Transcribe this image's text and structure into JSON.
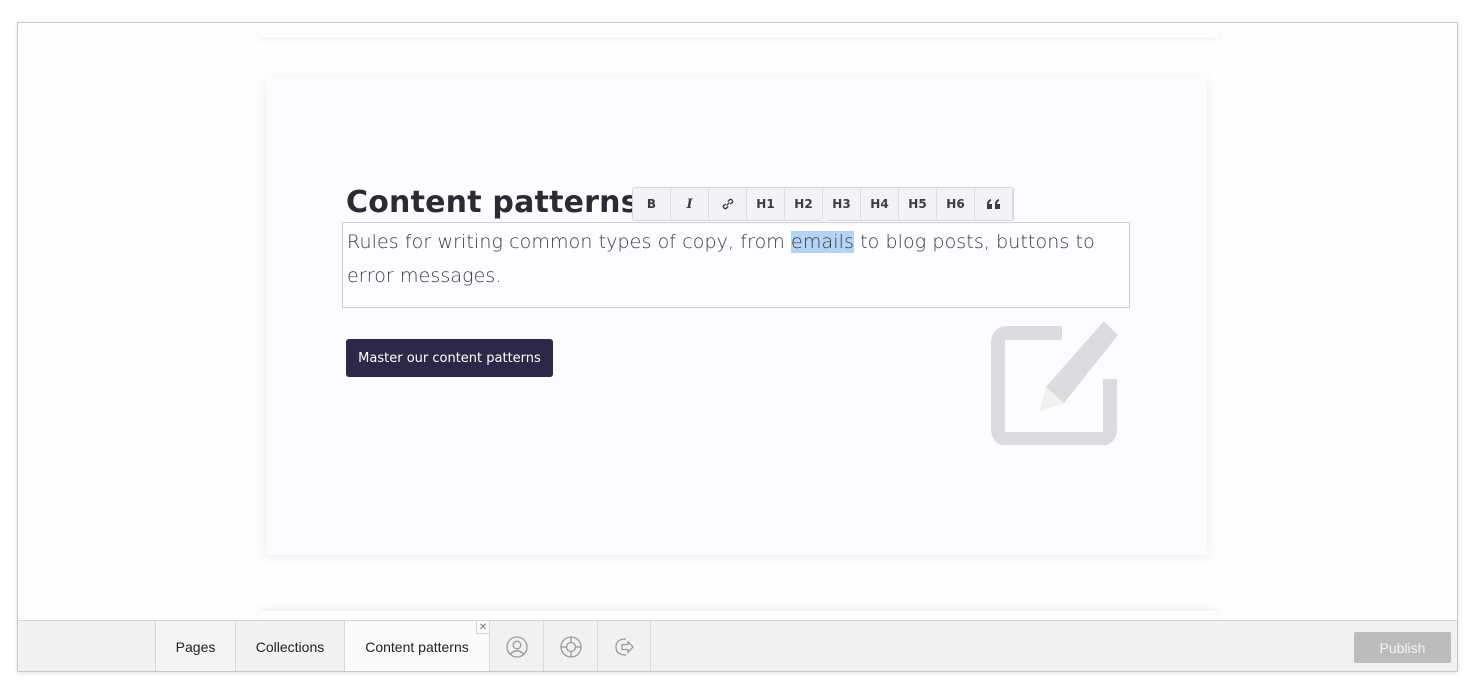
{
  "content": {
    "title": "Content patterns",
    "body_before": "Rules for writing common types of copy, from ",
    "body_selected": "emails",
    "body_after": " to blog posts, buttons to error messages.",
    "cta_label": "Master our content patterns",
    "watermark_icon": "edit-icon"
  },
  "toolbar": {
    "buttons": [
      {
        "label": "B",
        "icon": "bold-icon"
      },
      {
        "label": "I",
        "icon": "italic-icon"
      },
      {
        "label": "",
        "icon": "link-icon"
      },
      {
        "label": "H1"
      },
      {
        "label": "H2"
      },
      {
        "label": "H3"
      },
      {
        "label": "H4"
      },
      {
        "label": "H5"
      },
      {
        "label": "H6"
      },
      {
        "label": "",
        "icon": "quote-icon"
      }
    ]
  },
  "bottom_bar": {
    "tabs": [
      {
        "label": "Pages"
      },
      {
        "label": "Collections"
      },
      {
        "label": "Content patterns"
      }
    ],
    "icons": [
      "user-icon",
      "help-icon",
      "logout-icon"
    ],
    "publish_label": "Publish"
  },
  "colors": {
    "accent": "#2d2848",
    "selection": "#b5d3f5",
    "publish_disabled": "#bcbcbc"
  }
}
